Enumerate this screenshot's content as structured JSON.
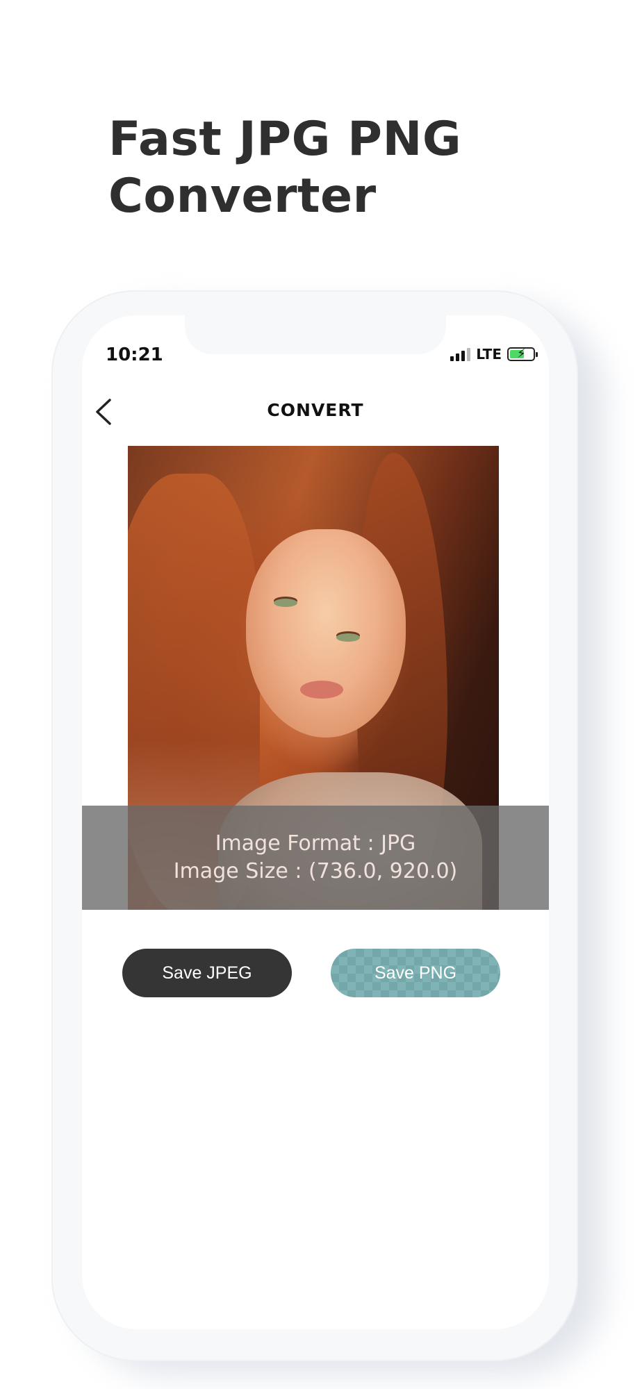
{
  "headline": {
    "line1": "Fast JPG PNG",
    "line2": "Converter"
  },
  "status_bar": {
    "time": "10:21",
    "network": "LTE",
    "battery_icon": "battery-charging-icon",
    "signal_icon": "signal-icon"
  },
  "nav": {
    "title": "CONVERT",
    "back_icon": "chevron-left-icon"
  },
  "image_info": {
    "format": "Image Format : JPG",
    "size": "Image Size : (736.0, 920.0)"
  },
  "actions": {
    "save_jpeg": "Save JPEG",
    "save_png": "Save PNG"
  },
  "colors": {
    "headline": "#2f2f2f",
    "jpeg_button": "#353535",
    "png_button": "#7fb3b5",
    "battery_fill": "#4cd964"
  }
}
